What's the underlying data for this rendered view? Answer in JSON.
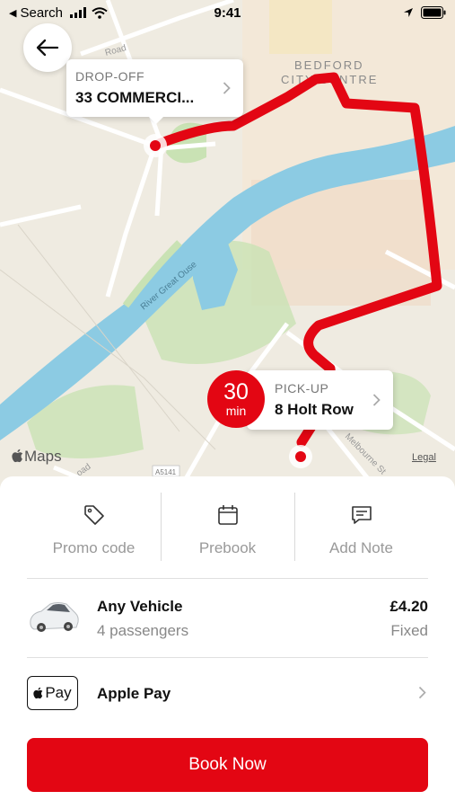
{
  "status_bar": {
    "back_app": "Search",
    "time": "9:41"
  },
  "map": {
    "area_label_line1": "BEDFORD",
    "area_label_line2": "CITY CENTRE",
    "river_label": "River Great Ouse",
    "road_label_top": "Road",
    "road_label_bottom": "oad",
    "road_label_melbourne": "Melbourne St",
    "road_code": "A5141",
    "attribution_logo": "Maps",
    "legal_link": "Legal",
    "route_color": "#e30613"
  },
  "dropoff": {
    "label": "DROP-OFF",
    "address": "33 COMMERCI..."
  },
  "pickup": {
    "label": "PICK-UP",
    "address": "8 Holt Row"
  },
  "eta": {
    "value": "30",
    "unit": "min"
  },
  "actions": [
    {
      "label": "Promo code",
      "icon": "tag-icon"
    },
    {
      "label": "Prebook",
      "icon": "calendar-icon"
    },
    {
      "label": "Add Note",
      "icon": "message-icon"
    }
  ],
  "vehicle": {
    "name": "Any Vehicle",
    "passengers": "4 passengers",
    "price": "£4.20",
    "price_type": "Fixed"
  },
  "payment": {
    "badge": "Pay",
    "label": "Apple Pay"
  },
  "book_button": "Book Now",
  "colors": {
    "accent": "#e30613",
    "river": "#8ccbe3",
    "park": "#c9e2b4"
  }
}
